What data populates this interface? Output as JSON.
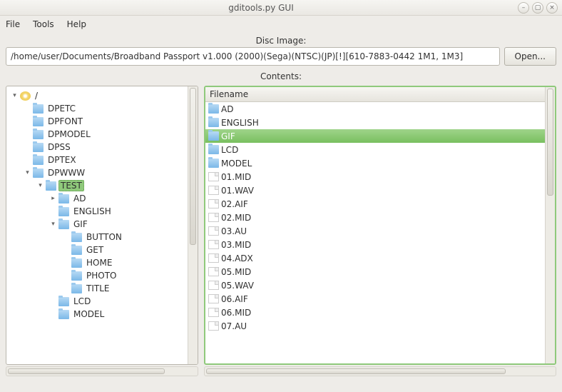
{
  "window": {
    "title": "gditools.py GUI"
  },
  "menu": {
    "file": "File",
    "tools": "Tools",
    "help": "Help"
  },
  "disc": {
    "label": "Disc Image:",
    "path": "/home/user/Documents/Broadband Passport v1.000 (2000)(Sega)(NTSC)(JP)[!][610-7883-0442 1M1, 1M3]",
    "open": "Open..."
  },
  "contents_label": "Contents:",
  "list_header": "Filename",
  "tree": [
    {
      "depth": 0,
      "exp": "open",
      "icon": "disc",
      "label": "/",
      "sel": false
    },
    {
      "depth": 1,
      "exp": "none",
      "icon": "folder",
      "label": "DPETC",
      "sel": false
    },
    {
      "depth": 1,
      "exp": "none",
      "icon": "folder",
      "label": "DPFONT",
      "sel": false
    },
    {
      "depth": 1,
      "exp": "none",
      "icon": "folder",
      "label": "DPMODEL",
      "sel": false
    },
    {
      "depth": 1,
      "exp": "none",
      "icon": "folder",
      "label": "DPSS",
      "sel": false
    },
    {
      "depth": 1,
      "exp": "none",
      "icon": "folder",
      "label": "DPTEX",
      "sel": false
    },
    {
      "depth": 1,
      "exp": "open",
      "icon": "folder",
      "label": "DPWWW",
      "sel": false
    },
    {
      "depth": 2,
      "exp": "open",
      "icon": "folder",
      "label": "TEST",
      "sel": true
    },
    {
      "depth": 3,
      "exp": "closed",
      "icon": "folder",
      "label": "AD",
      "sel": false
    },
    {
      "depth": 3,
      "exp": "none",
      "icon": "folder",
      "label": "ENGLISH",
      "sel": false
    },
    {
      "depth": 3,
      "exp": "open",
      "icon": "folder",
      "label": "GIF",
      "sel": false
    },
    {
      "depth": 4,
      "exp": "none",
      "icon": "folder",
      "label": "BUTTON",
      "sel": false
    },
    {
      "depth": 4,
      "exp": "none",
      "icon": "folder",
      "label": "GET",
      "sel": false
    },
    {
      "depth": 4,
      "exp": "none",
      "icon": "folder",
      "label": "HOME",
      "sel": false
    },
    {
      "depth": 4,
      "exp": "none",
      "icon": "folder",
      "label": "PHOTO",
      "sel": false
    },
    {
      "depth": 4,
      "exp": "none",
      "icon": "folder",
      "label": "TITLE",
      "sel": false
    },
    {
      "depth": 3,
      "exp": "none",
      "icon": "folder",
      "label": "LCD",
      "sel": false
    },
    {
      "depth": 3,
      "exp": "none",
      "icon": "folder",
      "label": "MODEL",
      "sel": false
    }
  ],
  "list": [
    {
      "icon": "folder",
      "name": "AD",
      "sel": false
    },
    {
      "icon": "folder",
      "name": "ENGLISH",
      "sel": false
    },
    {
      "icon": "folder",
      "name": "GIF",
      "sel": true
    },
    {
      "icon": "folder",
      "name": "LCD",
      "sel": false
    },
    {
      "icon": "folder",
      "name": "MODEL",
      "sel": false
    },
    {
      "icon": "file",
      "name": "01.MID",
      "sel": false
    },
    {
      "icon": "file",
      "name": "01.WAV",
      "sel": false
    },
    {
      "icon": "file",
      "name": "02.AIF",
      "sel": false
    },
    {
      "icon": "file",
      "name": "02.MID",
      "sel": false
    },
    {
      "icon": "file",
      "name": "03.AU",
      "sel": false
    },
    {
      "icon": "file",
      "name": "03.MID",
      "sel": false
    },
    {
      "icon": "file",
      "name": "04.ADX",
      "sel": false
    },
    {
      "icon": "file",
      "name": "05.MID",
      "sel": false
    },
    {
      "icon": "file",
      "name": "05.WAV",
      "sel": false
    },
    {
      "icon": "file",
      "name": "06.AIF",
      "sel": false
    },
    {
      "icon": "file",
      "name": "06.MID",
      "sel": false
    },
    {
      "icon": "file",
      "name": "07.AU",
      "sel": false
    }
  ]
}
